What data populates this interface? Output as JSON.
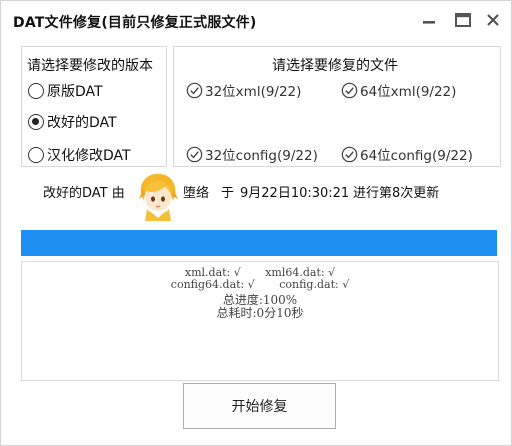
{
  "window": {
    "title": "DAT文件修复(目前只修复正式服文件)",
    "controls": [
      "minimize-icon",
      "maximize-icon",
      "close-icon"
    ]
  },
  "version_group": {
    "title": "请选择要修改的版本",
    "options": [
      {
        "label": "原版DAT",
        "checked": false
      },
      {
        "label": "改好的DAT",
        "checked": true
      },
      {
        "label": "汉化修改DAT",
        "checked": false
      }
    ]
  },
  "files_group": {
    "title": "请选择要修复的文件",
    "items": [
      {
        "label": "32位xml(9/22)",
        "checked": true
      },
      {
        "label": "64位xml(9/22)",
        "checked": true
      },
      {
        "label": "32位config(9/22)",
        "checked": true
      },
      {
        "label": "64位config(9/22)",
        "checked": true
      }
    ]
  },
  "status": {
    "prefix": "改好的DAT 由",
    "author": "堕络",
    "at": "于",
    "time": "9月22日10:30:21",
    "suffix": "进行第8次更新",
    "avatar_icon": "anime-avatar-icon"
  },
  "progress": {
    "value": 1.0,
    "color": "#1e8ff2"
  },
  "log": {
    "lines": [
      "xml.dat: √       xml64.dat: √",
      "config64.dat: √       config.dat: √",
      "总进度:100%",
      "总耗时:0分10秒"
    ]
  },
  "actions": {
    "start_label": "开始修复"
  }
}
